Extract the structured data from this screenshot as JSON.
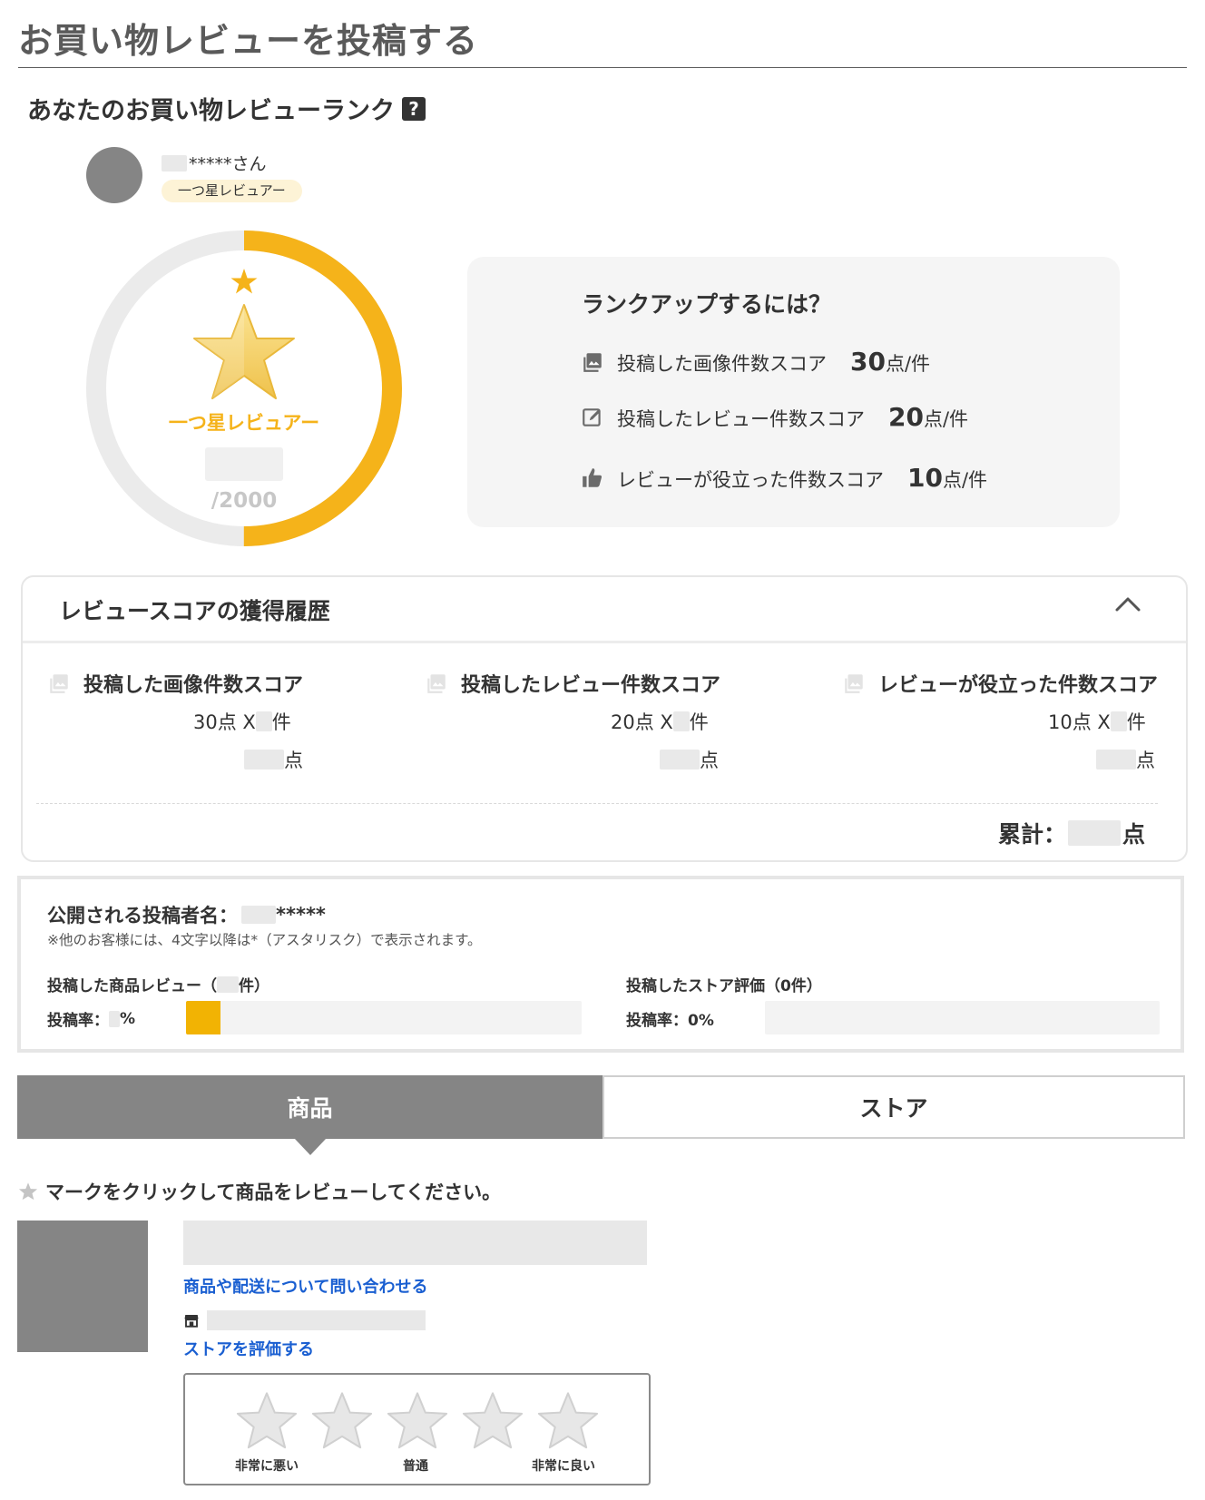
{
  "page": {
    "title": "お買い物レビューを投稿する"
  },
  "rank": {
    "heading": "あなたのお買い物レビューランク",
    "help_icon": "?",
    "user_suffix": "*****さん",
    "badge": "一つ星レビュアー",
    "rank_name": "一つ星レビュアー",
    "max_score": "/2000",
    "progress_fraction": 0.5
  },
  "rankup": {
    "title": "ランクアップするには？",
    "rows": [
      {
        "label": "投稿した画像件数スコア",
        "points": "30",
        "unit": "点/件"
      },
      {
        "label": "投稿したレビュー件数スコア",
        "points": "20",
        "unit": "点/件"
      },
      {
        "label": "レビューが役立った件数スコア",
        "points": "10",
        "unit": "点/件"
      }
    ]
  },
  "history": {
    "title": "レビュースコアの獲得履歴",
    "cols": [
      {
        "title": "投稿した画像件数スコア",
        "rate": "30点 X ",
        "count_unit": "件",
        "pts_unit": "点"
      },
      {
        "title": "投稿したレビュー件数スコア",
        "rate": "20点 X ",
        "count_unit": "件",
        "pts_unit": "点"
      },
      {
        "title": "レビューが役立った件数スコア",
        "rate": "10点 X ",
        "count_unit": "件",
        "pts_unit": "点"
      }
    ],
    "total_label": "累計：",
    "total_unit": "点"
  },
  "public": {
    "name_label": "公開される投稿者名：",
    "name_suffix": "*****",
    "note": "※他のお客様には、4文字以降は*（アスタリスク）で表示されます。",
    "product_reviews_prefix": "投稿した商品レビュー（",
    "product_reviews_suffix": "件）",
    "product_rate_prefix": "投稿率：",
    "product_rate_suffix": "%",
    "product_rate_fraction": 0.087,
    "store_reviews": "投稿したストア評価（0件）",
    "store_rate": "投稿率：0%",
    "store_rate_fraction": 0
  },
  "tabs": {
    "product": "商品",
    "store": "ストア"
  },
  "review": {
    "instruction": "マークをクリックして商品をレビューしてください。",
    "inquiry_link": "商品や配送について問い合わせる",
    "store_rate_link": "ストアを評価する",
    "labels": {
      "bad": "非常に悪い",
      "normal": "普通",
      "good": "非常に良い"
    }
  },
  "colors": {
    "accent": "#f5b31a",
    "bar_fill": "#f2b303",
    "tab_active": "#858585",
    "link": "#1a5fd1"
  },
  "icons": [
    "help-icon",
    "star-icon",
    "image-icon",
    "edit-icon",
    "thumbs-up-icon",
    "chevron-up-icon",
    "shop-icon"
  ]
}
